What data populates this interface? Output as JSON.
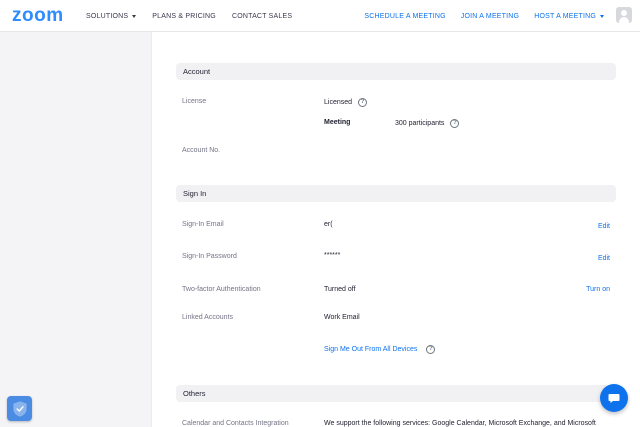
{
  "brand": {
    "logo_text": "zoom",
    "accent": "#2d8cff",
    "link_color": "#0e72ed"
  },
  "nav": {
    "left": [
      {
        "label": "SOLUTIONS",
        "has_caret": true
      },
      {
        "label": "PLANS & PRICING",
        "has_caret": false
      },
      {
        "label": "CONTACT SALES",
        "has_caret": false
      }
    ],
    "right": [
      {
        "label": "SCHEDULE A MEETING",
        "has_caret": false
      },
      {
        "label": "JOIN A MEETING",
        "has_caret": false
      },
      {
        "label": "HOST A MEETING",
        "has_caret": true
      }
    ],
    "avatar_icon": "user-avatar-icon"
  },
  "account": {
    "header": "Account",
    "license_label": "License",
    "license_value": "Licensed",
    "meeting_label": "Meeting",
    "meeting_value": "300 participants",
    "account_no_label": "Account No.",
    "account_no_value": ""
  },
  "signin": {
    "header": "Sign In",
    "email_label": "Sign-In Email",
    "email_value": "er(",
    "email_action": "Edit",
    "password_label": "Sign-In Password",
    "password_value": "******",
    "password_action": "Edit",
    "twofa_label": "Two-factor Authentication",
    "twofa_value": "Turned off",
    "twofa_action": "Turn on",
    "linked_label": "Linked Accounts",
    "linked_value": "Work Email",
    "signout_link": "Sign Me Out From All Devices"
  },
  "others": {
    "header": "Others",
    "calendar_label": "Calendar and Contacts Integration",
    "calendar_value": "We support the following services: Google Calendar, Microsoft Exchange, and Microsoft"
  },
  "icons": {
    "help": "help-circle-icon",
    "shield": "shield-check-icon",
    "chat": "chat-bubble-icon"
  }
}
